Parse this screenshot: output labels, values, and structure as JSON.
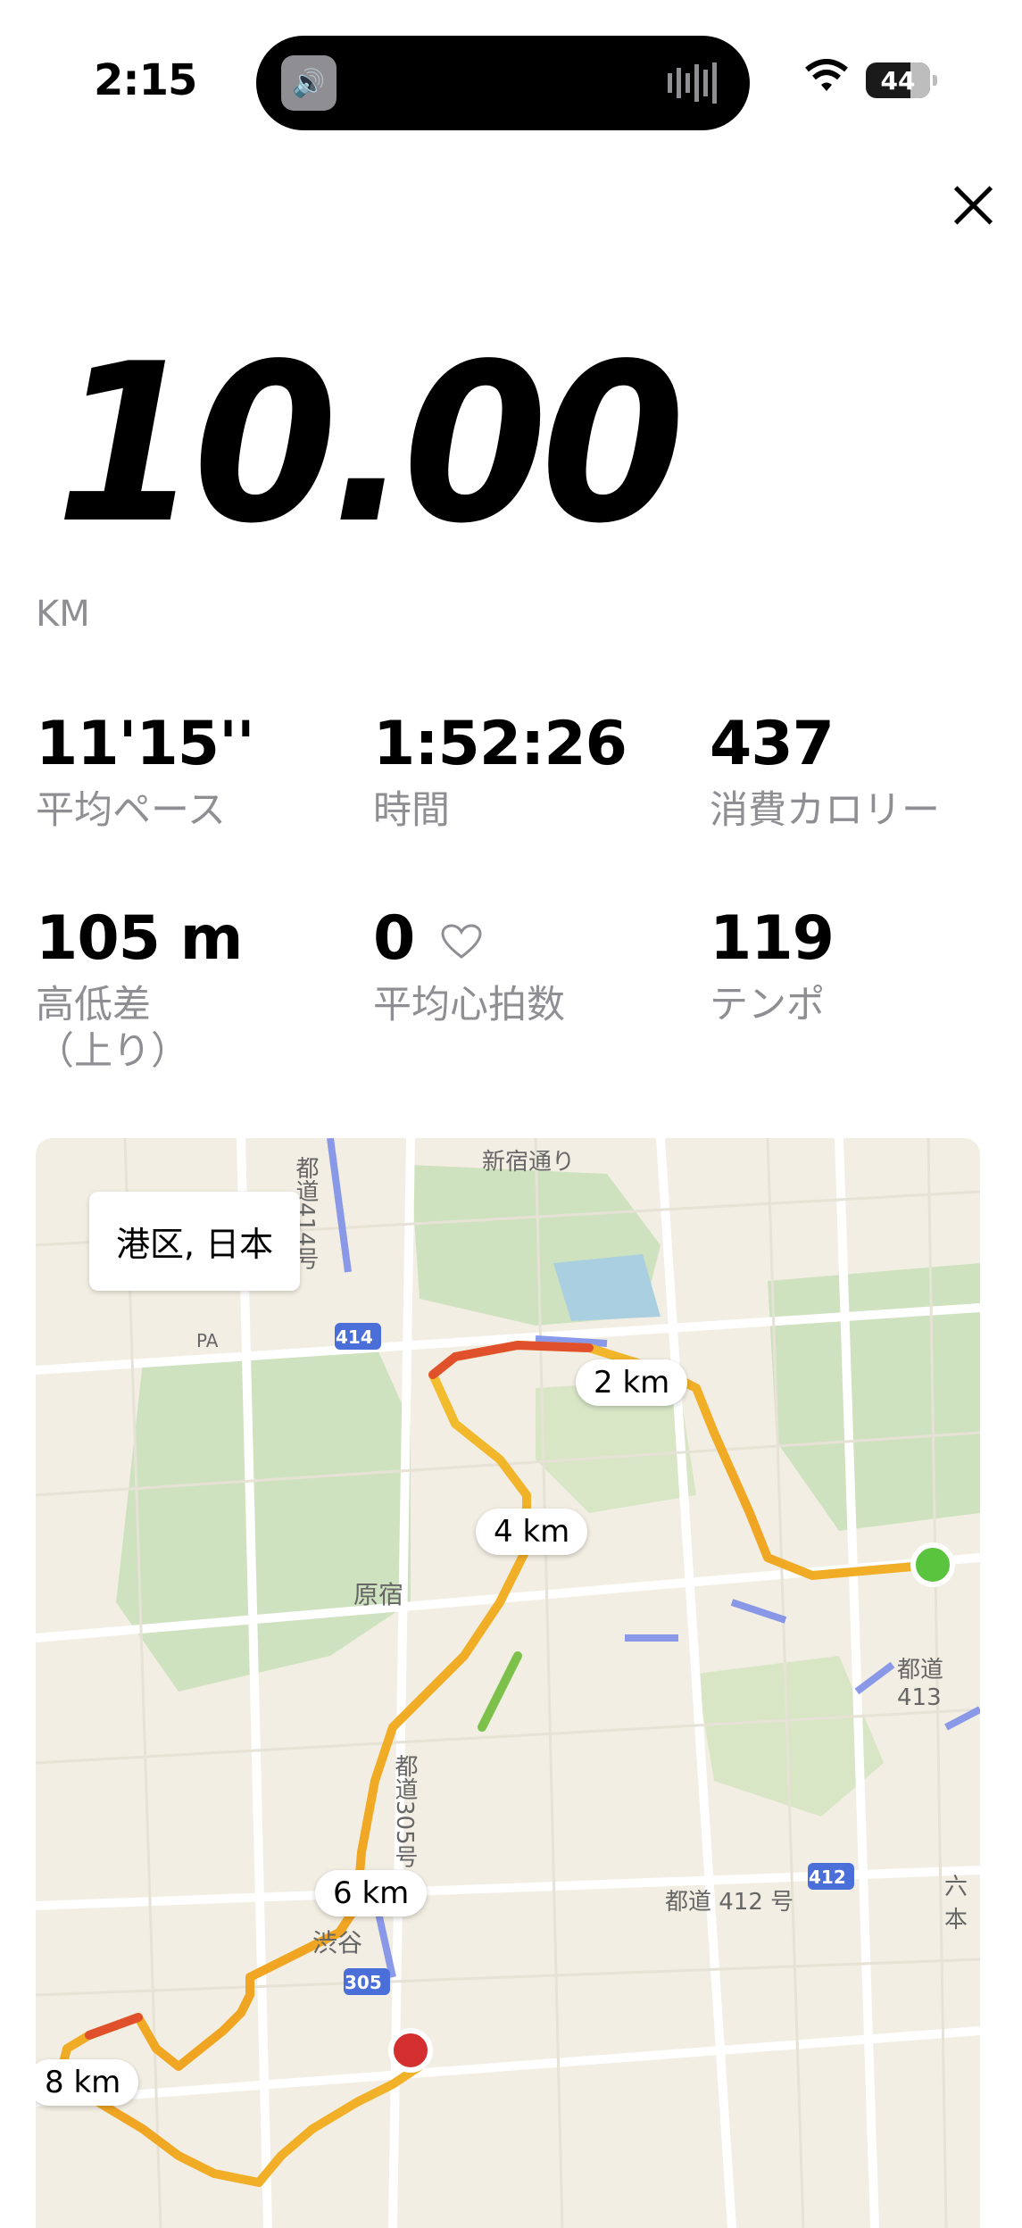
{
  "status": {
    "time": "2:15",
    "battery": "44"
  },
  "run": {
    "distance": "10.00",
    "unit": "KM"
  },
  "stats": [
    {
      "value": "11'15''",
      "label": "平均ペース"
    },
    {
      "value": "1:52:26",
      "label": "時間"
    },
    {
      "value": "437",
      "label": "消費カロリー"
    },
    {
      "value": "105 m",
      "label": "高低差\n（上り）"
    },
    {
      "value": "0",
      "label": "平均心拍数"
    },
    {
      "value": "119",
      "label": "テンポ"
    }
  ],
  "map": {
    "location": "港区, 日本",
    "markers": [
      "2 km",
      "4 km",
      "6 km",
      "8 km"
    ],
    "labels": {
      "harajuku": "原宿",
      "shibuya": "渋谷",
      "shinjuku_street": "新宿通り",
      "route414": "414",
      "route305": "305",
      "route412": "412",
      "todo412": "都道 412 号",
      "todo413": "都道 413",
      "todo305": "都道305号",
      "todo414": "都道414号",
      "roppongi": "六本",
      "pa": "PA"
    },
    "start_color": "#5ac43f",
    "end_color": "#d32f2f"
  }
}
